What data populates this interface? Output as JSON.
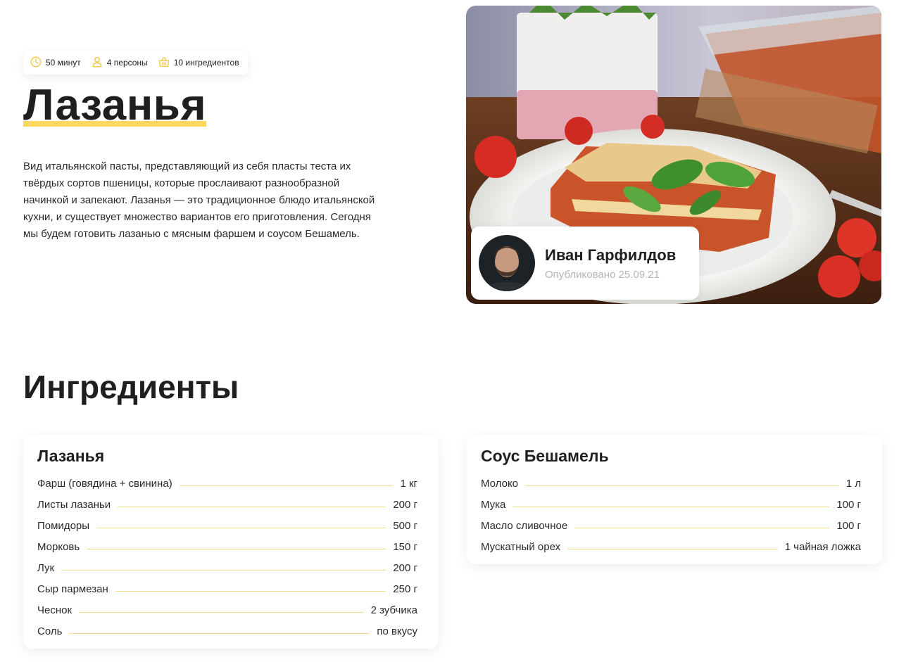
{
  "meta": {
    "time": "50 минут",
    "persons": "4 персоны",
    "ingredients_count": "10 ингредиентов"
  },
  "recipe": {
    "title": "Лазанья",
    "description": "Вид итальянской пасты, представляющий из себя пласты теста их твёрдых сортов пшеницы, которые прослаивают разнообразной начинкой и запекают. Лазанья — это традиционное блюдо итальянской кухни, и существует множество вариантов его приготовления. Сегодня мы будем готовить лазанью с мясным фаршем и соусом Бешамель."
  },
  "author": {
    "name": "Иван Гарфилдов",
    "published": "Опубликовано 25.09.21"
  },
  "ingredients_section": {
    "title": "Ингредиенты",
    "groups": [
      {
        "title": "Лазанья",
        "items": [
          {
            "name": "Фарш (говядина + свинина)",
            "qty": "1 кг"
          },
          {
            "name": "Листы лазаньи",
            "qty": "200 г"
          },
          {
            "name": "Помидоры",
            "qty": "500 г"
          },
          {
            "name": "Морковь",
            "qty": "150 г"
          },
          {
            "name": "Лук",
            "qty": "200 г"
          },
          {
            "name": "Сыр пармезан",
            "qty": "250 г"
          },
          {
            "name": "Чеснок",
            "qty": "2 зубчика"
          },
          {
            "name": "Соль",
            "qty": "по вкусу"
          }
        ]
      },
      {
        "title": "Соус Бешамель",
        "items": [
          {
            "name": "Молоко",
            "qty": "1 л"
          },
          {
            "name": "Мука",
            "qty": "100 г"
          },
          {
            "name": "Масло сливочное",
            "qty": "100 г"
          },
          {
            "name": "Мускатный орех",
            "qty": "1 чайная ложка"
          }
        ]
      }
    ]
  },
  "colors": {
    "accent": "#fcd85e",
    "icon": "#f2c94c",
    "leader": "#f1dd86",
    "muted": "#b5b5b5"
  },
  "icons": [
    "clock-icon",
    "person-icon",
    "basket-icon"
  ]
}
